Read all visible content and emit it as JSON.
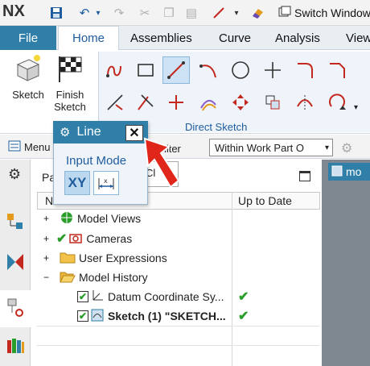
{
  "app": {
    "logo": "NX",
    "switch_window_label": "Switch Window"
  },
  "quick_access": {
    "icons": [
      "save-icon",
      "undo-icon",
      "redo-icon",
      "cut-icon",
      "copy-icon",
      "paste-icon",
      "line-tool-icon",
      "eraser-icon",
      "switch-window-icon"
    ]
  },
  "ribbon": {
    "file_label": "File",
    "tabs": [
      "Home",
      "Assemblies",
      "Curve",
      "Analysis",
      "View"
    ],
    "active_tab": "Home",
    "sketch_label": "Sketch",
    "finish_sketch_label": "Finish Sketch",
    "group_label": "Direct Sketch"
  },
  "toolbar": {
    "menu_label": "Menu",
    "filter_label": "Filter",
    "scope_value": "Within Work Part O"
  },
  "line_dialog": {
    "title": "Line",
    "input_mode_label": "Input Mode",
    "xy_label": "XY",
    "fragment_label": "Cl"
  },
  "navigator": {
    "title_fragment": "Pa",
    "col_name": "N",
    "col_uptodate": "Up to Date",
    "rows": [
      {
        "label": "Model Views",
        "check": false,
        "bold": false
      },
      {
        "label": "Cameras",
        "check": true,
        "bold": false
      },
      {
        "label": "User Expressions",
        "check": false,
        "bold": false
      },
      {
        "label": "Model History",
        "check": false,
        "bold": false
      },
      {
        "label": "Datum Coordinate Sy...",
        "check": true,
        "bold": false,
        "uptodate": true
      },
      {
        "label": "Sketch (1) \"SKETCH...",
        "check": true,
        "bold": true,
        "uptodate": true
      }
    ]
  },
  "graphics": {
    "tab_label": "mo"
  },
  "colors": {
    "accent": "#2f7fa8",
    "check_green": "#2a9d2a",
    "arrow_red": "#e0261b"
  }
}
